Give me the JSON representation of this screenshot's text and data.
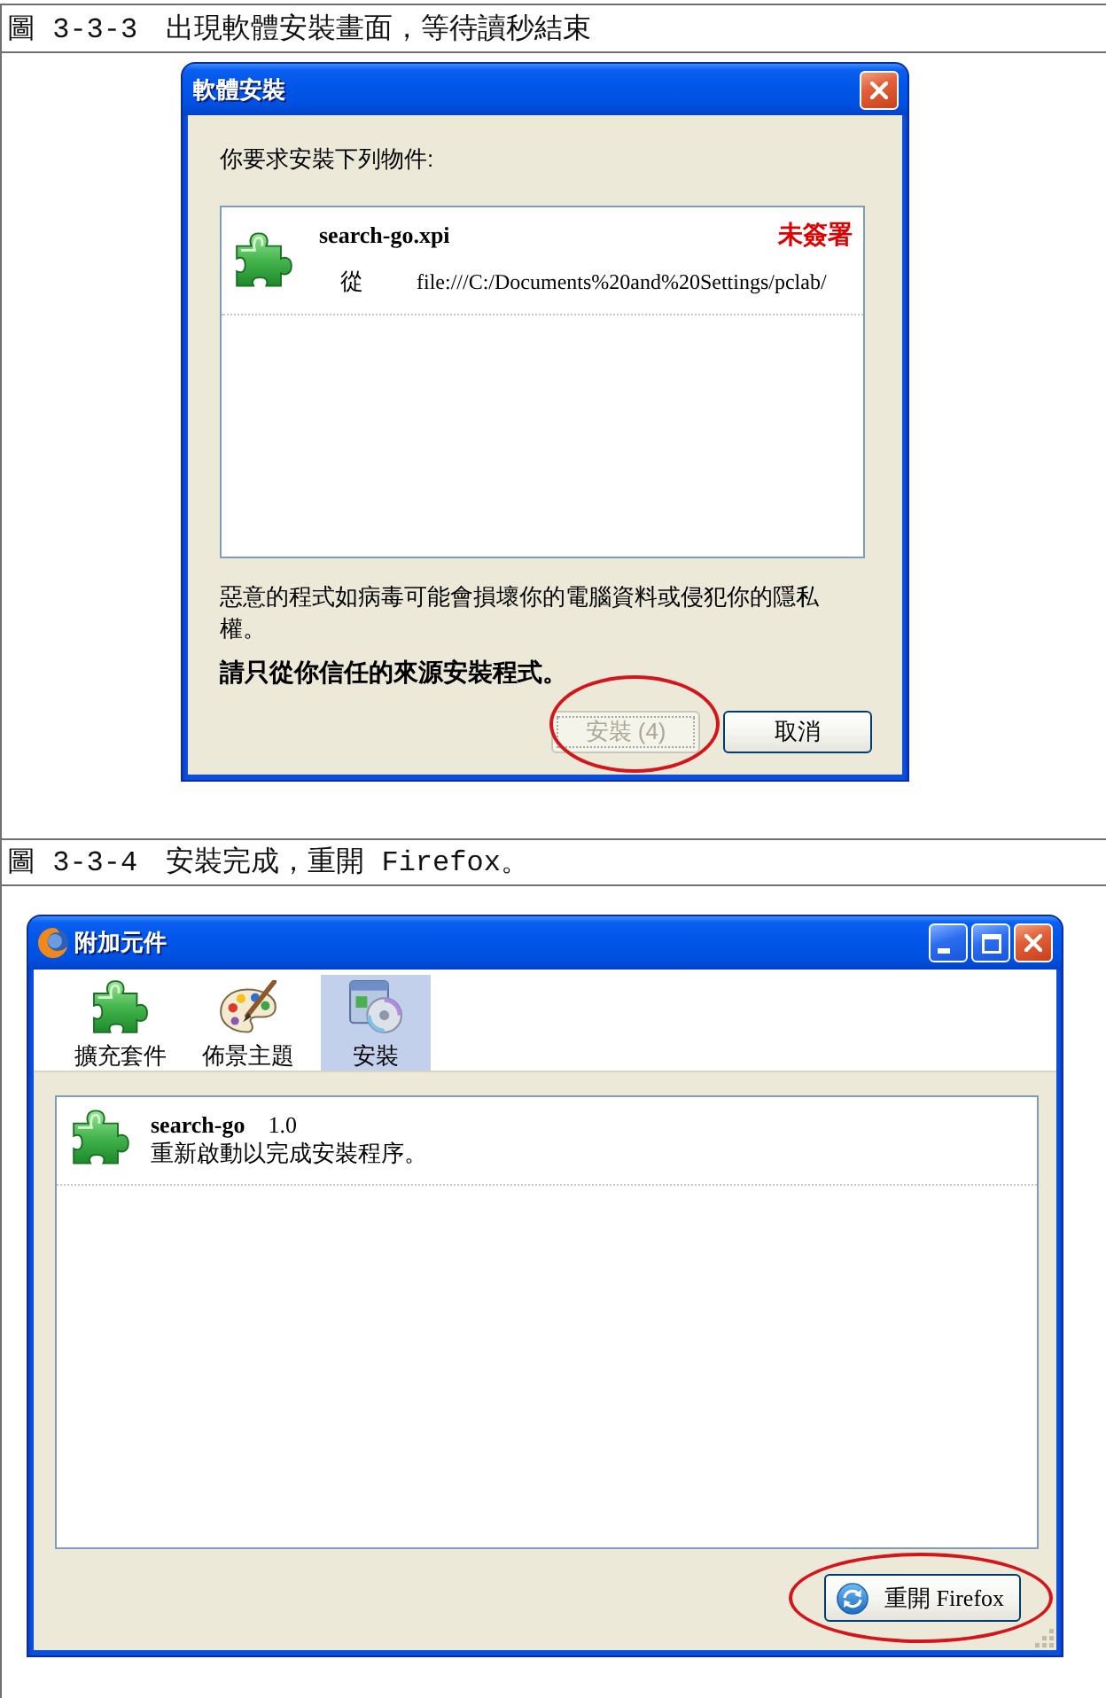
{
  "figures": [
    {
      "kind": "install-dialog",
      "caption": "圖 3-3-3　出現軟體安裝畫面，等待讀秒結束",
      "dialog": {
        "title": "軟體安裝",
        "prompt": "你要求安裝下列物件:",
        "items": [
          {
            "name": "search-go.xpi",
            "signature": "未簽署",
            "from_label": "從",
            "source": "file:///C:/Documents%20and%20Settings/pclab/"
          }
        ],
        "warning": "惡意的程式如病毒可能會損壞你的電腦資料或侵犯你的隱私權。",
        "advice": "請只從你信任的來源安裝程式。",
        "buttons": [
          {
            "label": "安裝 (4)",
            "disabled": true,
            "circled": true
          },
          {
            "label": "取消",
            "disabled": false,
            "circled": false
          }
        ]
      }
    },
    {
      "kind": "addons-window",
      "caption": "圖 3-3-4　安裝完成，重開 Firefox。",
      "window": {
        "title": "附加元件",
        "tabs": [
          {
            "kind": "extensions",
            "label": "擴充套件",
            "selected": false
          },
          {
            "kind": "themes",
            "label": "佈景主題",
            "selected": false
          },
          {
            "kind": "install",
            "label": "安裝",
            "selected": true
          }
        ],
        "items": [
          {
            "name": "search-go",
            "version": "1.0",
            "description": "重新啟動以完成安裝程序。"
          }
        ],
        "buttons": [
          {
            "label": "重開 Firefox",
            "circled": true
          }
        ]
      }
    }
  ]
}
